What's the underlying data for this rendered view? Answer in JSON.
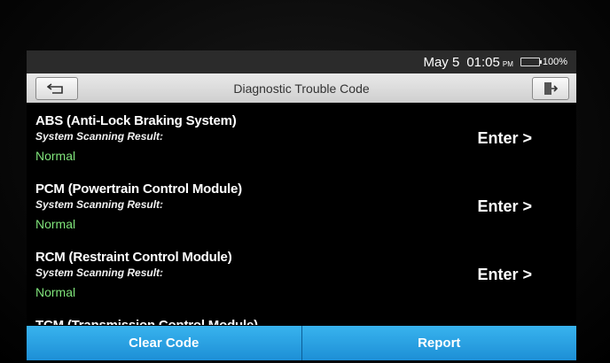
{
  "status": {
    "date": "May 5",
    "time": "01:05",
    "ampm": "PM",
    "battery": "100%",
    "battery_level": 1.0
  },
  "titlebar": {
    "title": "Diagnostic Trouble Code",
    "back_icon": "back-arrow-icon",
    "exit_icon": "exit-door-icon"
  },
  "modules": [
    {
      "name": "ABS (Anti-Lock Braking System)",
      "result_label": "System Scanning Result:",
      "result": "Normal",
      "enter": "Enter >"
    },
    {
      "name": "PCM (Powertrain Control Module)",
      "result_label": "System Scanning Result:",
      "result": "Normal",
      "enter": "Enter >"
    },
    {
      "name": "RCM (Restraint Control Module)",
      "result_label": "System Scanning Result:",
      "result": "Normal",
      "enter": "Enter >"
    },
    {
      "name": "TCM (Transmission Control Module)"
    }
  ],
  "footer": {
    "clear_label": "Clear Code",
    "report_label": "Report"
  },
  "colors": {
    "normal": "#7fe37a",
    "button": "#2aa3e6"
  }
}
